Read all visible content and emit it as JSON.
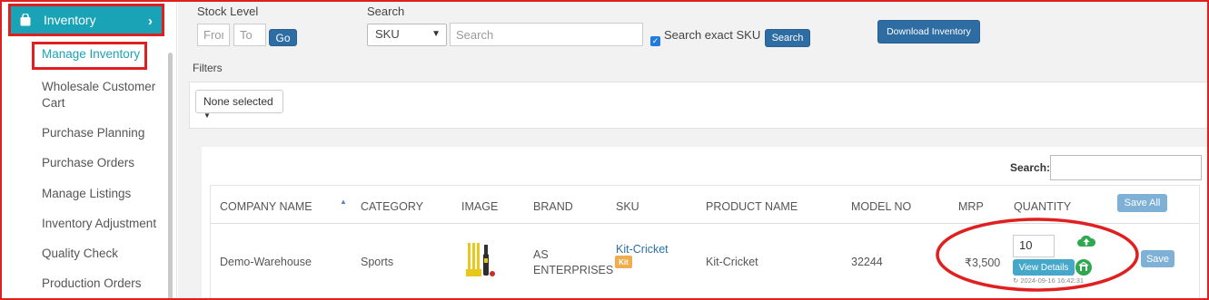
{
  "sidebar": {
    "header": "Inventory",
    "header_chevron": "›",
    "items": [
      {
        "label": "Manage Inventory"
      },
      {
        "label": "Wholesale Customer"
      },
      {
        "label": "Cart"
      },
      {
        "label": "Purchase Planning"
      },
      {
        "label": "Purchase Orders"
      },
      {
        "label": "Manage Listings"
      },
      {
        "label": "Inventory Adjustment"
      },
      {
        "label": "Quality Check"
      },
      {
        "label": "Production Orders"
      }
    ]
  },
  "filters_top": {
    "stock_level_label": "Stock Level",
    "from_placeholder": "From",
    "to_placeholder": "To",
    "go_label": "Go",
    "search_label": "Search",
    "search_type_value": "SKU",
    "search_placeholder": "Search",
    "exact_sku_label": "Search exact SKU",
    "search_button": "Search",
    "download_button": "Download Inventory",
    "filters_label": "Filters",
    "none_selected": "None selected"
  },
  "table": {
    "search_label": "Search:",
    "save_all": "Save All",
    "columns": [
      "COMPANY NAME",
      "CATEGORY",
      "IMAGE",
      "BRAND",
      "SKU",
      "PRODUCT NAME",
      "MODEL NO",
      "MRP",
      "QUANTITY"
    ],
    "rows": [
      {
        "company": "Demo-Warehouse",
        "category": "Sports",
        "brand_line1": "AS",
        "brand_line2": "ENTERPRISES",
        "sku": "Kit-Cricket",
        "sku_badge": "Kit",
        "product": "Kit-Cricket",
        "model": "32244",
        "mrp": "₹3,500",
        "quantity": "10",
        "view_details": "View Details",
        "timestamp": "2024-09-16 16:42:31",
        "save": "Save"
      }
    ]
  },
  "colors": {
    "accent": "#1aa3b6",
    "annotation_red": "#e02020",
    "button_blue": "#2e6da4",
    "light_blue": "#7fb0d6",
    "upload_green": "#2fa84f"
  }
}
